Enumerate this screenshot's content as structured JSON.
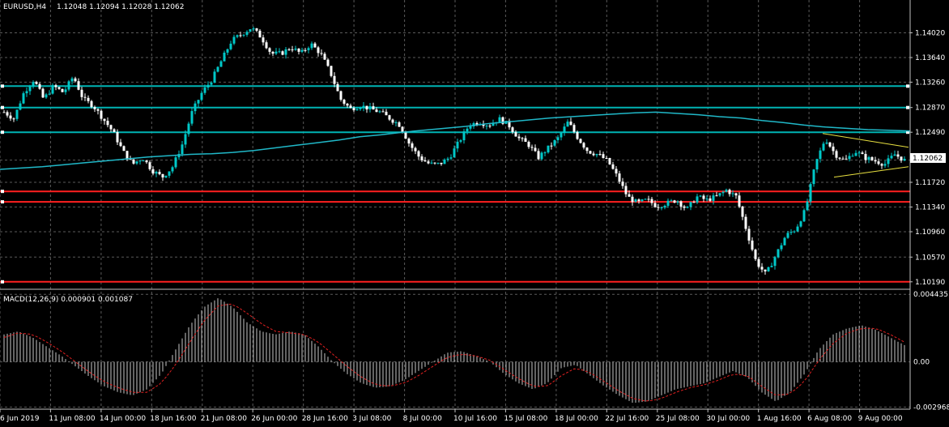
{
  "header": {
    "symbol": "EURUSD,H4",
    "ohlc": "1.12048 1.12094 1.12028 1.12062"
  },
  "macd_header": {
    "label": "MACD(12,26,9) 0.000901 0.001087"
  },
  "current_price_label": "1.12062",
  "colors": {
    "background": "#000000",
    "grid": "#5a5a5a",
    "bull_candle": "#00c8c8",
    "bear_candle": "#ffffff",
    "ma": "#20b8c8",
    "hline_cyan": "#00b4b4",
    "hline_red": "#ff2020",
    "triangle": "#e8e040",
    "macd_hist": "#c8c8c8",
    "macd_signal": "#e02020"
  },
  "chart_data": [
    {
      "type": "candlestick",
      "name": "EURUSD,H4",
      "ylim": [
        1.101,
        1.143
      ],
      "y_ticks": [
        "1.14020",
        "1.13640",
        "1.13260",
        "1.12870",
        "1.12490",
        "1.12062",
        "1.11720",
        "1.11340",
        "1.10960",
        "1.10570",
        "1.10190"
      ],
      "x_ticks": [
        "6 Jun 2019",
        "11 Jun 08:00",
        "14 Jun 00:00",
        "18 Jun 16:00",
        "21 Jun 08:00",
        "26 Jun 00:00",
        "28 Jun 16:00",
        "3 Jul 08:00",
        "8 Jul 00:00",
        "10 Jul 16:00",
        "15 Jul 08:00",
        "18 Jul 00:00",
        "22 Jul 16:00",
        "25 Jul 08:00",
        "30 Jul 00:00",
        "1 Aug 16:00",
        "6 Aug 08:00",
        "9 Aug 00:00"
      ],
      "close_path": [
        1.128,
        1.127,
        1.131,
        1.133,
        1.13,
        1.132,
        1.131,
        1.1335,
        1.13,
        1.129,
        1.127,
        1.125,
        1.122,
        1.12,
        1.121,
        1.119,
        1.118,
        1.1195,
        1.123,
        1.128,
        1.131,
        1.133,
        1.136,
        1.139,
        1.14,
        1.141,
        1.1395,
        1.137,
        1.137,
        1.138,
        1.137,
        1.1385,
        1.137,
        1.134,
        1.13,
        1.1285,
        1.129,
        1.1285,
        1.128,
        1.127,
        1.126,
        1.123,
        1.121,
        1.12,
        1.12,
        1.121,
        1.1235,
        1.126,
        1.1265,
        1.126,
        1.127,
        1.126,
        1.124,
        1.123,
        1.121,
        1.1225,
        1.124,
        1.1265,
        1.124,
        1.122,
        1.1215,
        1.1205,
        1.118,
        1.115,
        1.114,
        1.1145,
        1.1135,
        1.114,
        1.1145,
        1.113,
        1.115,
        1.1145,
        1.115,
        1.116,
        1.115,
        1.11,
        1.105,
        1.103,
        1.106,
        1.109,
        1.11,
        1.113,
        1.12,
        1.124,
        1.1215,
        1.1205,
        1.122,
        1.121,
        1.1205,
        1.12,
        1.1215,
        1.1206
      ],
      "moving_average": [
        1.1192,
        1.1194,
        1.1196,
        1.1199,
        1.1202,
        1.1205,
        1.1208,
        1.1211,
        1.1213,
        1.1215,
        1.1216,
        1.1218,
        1.1221,
        1.1225,
        1.1229,
        1.1233,
        1.1237,
        1.1242,
        1.1245,
        1.1249,
        1.1252,
        1.1255,
        1.1258,
        1.1262,
        1.1265,
        1.1268,
        1.1271,
        1.1273,
        1.1275,
        1.1277,
        1.1279,
        1.128,
        1.1278,
        1.1276,
        1.1273,
        1.1271,
        1.1267,
        1.1264,
        1.126,
        1.1257,
        1.1255,
        1.1253,
        1.1252,
        1.1251
      ],
      "horizontal_levels_cyan": [
        1.132,
        1.1287,
        1.1249
      ],
      "horizontal_levels_red": [
        1.1158,
        1.1142,
        1.1019
      ],
      "triangle": {
        "upper": [
          1.1247,
          1.1226
        ],
        "lower": [
          1.118,
          1.1196
        ]
      },
      "current_price": 1.12062
    },
    {
      "type": "histogram",
      "name": "MACD(12,26,9)",
      "values_text": "0.000901 0.001087",
      "ylim": [
        -0.003,
        0.0045
      ],
      "y_ticks": [
        "0.004435",
        "0.00",
        "-0.002968"
      ],
      "histogram": [
        0.0018,
        0.002,
        0.0016,
        0.001,
        0.0004,
        -0.0003,
        -0.001,
        -0.0016,
        -0.002,
        -0.0022,
        -0.0018,
        -0.0008,
        0.0008,
        0.0024,
        0.0036,
        0.0042,
        0.0036,
        0.0026,
        0.002,
        0.0018,
        0.002,
        0.0018,
        0.001,
        0.0,
        -0.0008,
        -0.0014,
        -0.0017,
        -0.0016,
        -0.0012,
        -0.0006,
        0.0,
        0.0006,
        0.0007,
        0.0004,
        0.0,
        -0.0008,
        -0.0014,
        -0.0018,
        -0.0014,
        -0.0004,
        -0.0002,
        -0.0009,
        -0.0016,
        -0.0022,
        -0.0027,
        -0.0026,
        -0.0022,
        -0.0018,
        -0.0016,
        -0.0014,
        -0.001,
        -0.0006,
        -0.001,
        -0.002,
        -0.0026,
        -0.002,
        -0.0008,
        0.0008,
        0.0018,
        0.0022,
        0.0024,
        0.0021,
        0.0016,
        0.0011
      ],
      "signal": [
        0.0016,
        0.0019,
        0.0018,
        0.0013,
        0.0007,
        0.0,
        -0.0007,
        -0.0013,
        -0.0017,
        -0.002,
        -0.002,
        -0.0014,
        -0.0002,
        0.0013,
        0.0027,
        0.0037,
        0.0038,
        0.0032,
        0.0025,
        0.002,
        0.0019,
        0.0018,
        0.0013,
        0.0005,
        -0.0003,
        -0.001,
        -0.0015,
        -0.0016,
        -0.0014,
        -0.0009,
        -0.0003,
        0.0003,
        0.0005,
        0.0004,
        0.0001,
        -0.0005,
        -0.0011,
        -0.0016,
        -0.0016,
        -0.0009,
        -0.0004,
        -0.0007,
        -0.0013,
        -0.0019,
        -0.0024,
        -0.0026,
        -0.0024,
        -0.002,
        -0.0017,
        -0.0015,
        -0.0012,
        -0.0008,
        -0.0009,
        -0.0016,
        -0.0022,
        -0.0021,
        -0.0013,
        0.0001,
        0.0012,
        0.0019,
        0.0022,
        0.0022,
        0.0018,
        0.0013
      ]
    }
  ]
}
